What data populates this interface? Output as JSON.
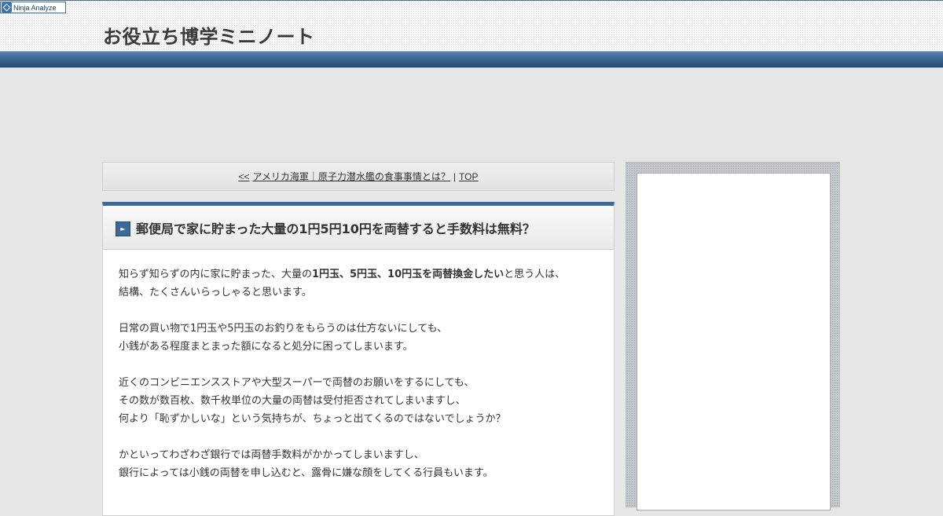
{
  "ninja": {
    "label": "Ninja Analyze"
  },
  "site": {
    "title": "お役立ち博学ミニノート"
  },
  "nav": {
    "prev_prefix": "<<",
    "prev_link": "アメリカ海軍｜原子力潜水艦の食事事情とは？",
    "separator": "|",
    "top_link": "TOP"
  },
  "article": {
    "title": "郵便局で家に貯まった大量の1円5円10円を両替すると手数料は無料？",
    "p1": {
      "l1_before": "知らず知らずの内に家に貯まった、大量の",
      "l1_bold": "1円玉、5円玉、10円玉を両替換金したい",
      "l1_after": "と思う人は、",
      "l2": "結構、たくさんいらっしゃると思います。"
    },
    "p2": {
      "l1": "日常の買い物で1円玉や5円玉のお釣りをもらうのは仕方ないにしても、",
      "l2": "小銭がある程度まとまった額になると処分に困ってしまいます。"
    },
    "p3": {
      "l1": "近くのコンビニエンスストアや大型スーパーで両替のお願いをするにしても、",
      "l2": "その数が数百枚、数千枚単位の大量の両替は受付拒否されてしまいますし、",
      "l3": "何より「恥ずかしいな」という気持ちが、ちょっと出てくるのではないでしょうか？"
    },
    "p4": {
      "l1": "かといってわざわざ銀行では両替手数料がかかってしまいますし、",
      "l2": "銀行によっては小銭の両替を申し込むと、露骨に嫌な顔をしてくる行員もいます。"
    }
  }
}
